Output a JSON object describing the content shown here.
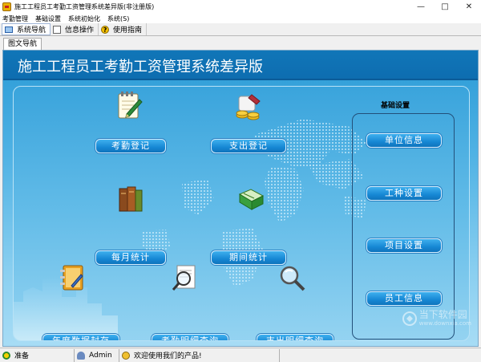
{
  "window": {
    "title": "施工工程员工考勤工资管理系统差异版(非注册版)",
    "controls": [
      "—",
      "□",
      "✕"
    ]
  },
  "menu": [
    "考勤管理",
    "基础设置",
    "系统初始化",
    "系统(S)"
  ],
  "toolbar": {
    "tabs": [
      {
        "label": "系统导航",
        "icon": "monitor-icon"
      },
      {
        "label": "信息操作",
        "icon": "document-icon"
      },
      {
        "label": "使用指南",
        "icon": "help-icon"
      }
    ]
  },
  "doc_tab": "图文导航",
  "banner_title": "施工工程员工考勤工资管理系统差异版",
  "functions": [
    {
      "label": "考勤登记",
      "icon": "notepad-pencil-icon"
    },
    {
      "label": "支出登记",
      "icon": "money-scroll-icon"
    },
    {
      "label": "每月统计",
      "icon": "books-icon"
    },
    {
      "label": "期间统计",
      "icon": "green-book-icon"
    },
    {
      "label": "年度数据封存",
      "icon": "notebook-icon"
    },
    {
      "label": "考勤明细查询",
      "icon": "magnifier-document-icon"
    },
    {
      "label": "支出明细查询",
      "icon": "magnifier-icon"
    }
  ],
  "side_panel": {
    "title": "基础设置",
    "buttons": [
      "单位信息",
      "工种设置",
      "项目设置",
      "员工信息"
    ]
  },
  "status": {
    "state": "准备",
    "user": "Admin",
    "message": "欢迎使用我们的产品!"
  },
  "watermark": {
    "text": "当下软件园",
    "url": "www.downxia.com"
  },
  "colors": {
    "banner": "#1076b8",
    "button": "#1687d4",
    "content_bg": "#63bce8"
  }
}
